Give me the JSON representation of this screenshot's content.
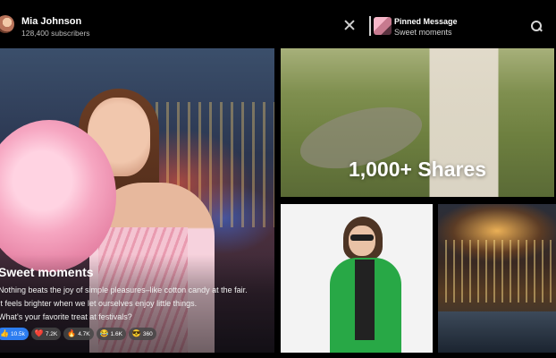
{
  "channel": {
    "name": "Mia Johnson",
    "subscribers": "128,400 subscribers"
  },
  "pinned": {
    "title": "Pinned Message",
    "text": "Sweet moments"
  },
  "icons": {
    "close": "close-icon",
    "search": "search-icon",
    "avatar": "avatar"
  },
  "post": {
    "title": "Sweet moments",
    "lines": [
      "Nothing beats the joy of simple pleasures–like cotton candy at the fair.",
      "It feels brighter when we let ourselves enjoy little things.",
      "What's your favorite treat at festivals?"
    ],
    "reactions": [
      {
        "emoji": "👍",
        "count": "10.5k"
      },
      {
        "emoji": "❤️",
        "count": "7.2K"
      },
      {
        "emoji": "🔥",
        "count": "4.7K"
      },
      {
        "emoji": "😂",
        "count": "1.6K"
      },
      {
        "emoji": "😎",
        "count": "360"
      }
    ]
  },
  "tiles": {
    "shares_label": "1,000+ Shares"
  },
  "colors": {
    "background": "#000000",
    "accent_blue": "#2d7df0",
    "coat_green": "#28a846"
  }
}
